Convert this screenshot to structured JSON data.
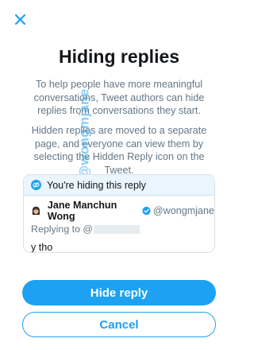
{
  "header": {
    "close_icon": "close-icon"
  },
  "dialog": {
    "title": "Hiding replies",
    "paragraph1": "To help people have more meaningful conversations, Tweet authors can hide replies from conversations they start.",
    "paragraph2": "Hidden replies are moved to a separate page, and everyone can view them by selecting the Hidden Reply icon on the Tweet."
  },
  "watermark": "@wongmjane",
  "card": {
    "banner_icon": "hidden-reply-icon",
    "banner_text": "You're hiding this reply",
    "tweet": {
      "avatar_icon": "avatar-emoji",
      "display_name": "Jane Manchun Wong",
      "verified_icon": "verified-badge-icon",
      "handle": "@wongmjane",
      "replying_to": "Replying to @",
      "body": "y tho"
    }
  },
  "actions": {
    "hide_label": "Hide reply",
    "cancel_label": "Cancel"
  },
  "colors": {
    "accent": "#1da1f2",
    "text": "#14171a",
    "secondary_text": "#657786",
    "banner_bg": "#eaf5fd",
    "border": "#d8e1e8"
  }
}
